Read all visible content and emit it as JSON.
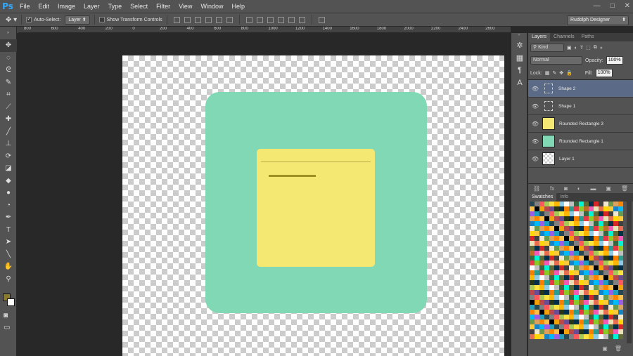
{
  "app": {
    "logo": "Ps"
  },
  "menu": [
    "File",
    "Edit",
    "Image",
    "Layer",
    "Type",
    "Select",
    "Filter",
    "View",
    "Window",
    "Help"
  ],
  "window_controls": [
    "—",
    "□",
    "✕"
  ],
  "options_bar": {
    "auto_select_label": "Auto-Select:",
    "auto_select_checked": true,
    "target_value": "Layer",
    "transform_label": "Show Transform Controls",
    "transform_checked": false,
    "workspace": "Rudolph Designer"
  },
  "ruler_ticks": [
    "800",
    "600",
    "400",
    "200",
    "0",
    "200",
    "400",
    "600",
    "800",
    "1000",
    "1200",
    "1400",
    "1600",
    "1800",
    "2000",
    "2200",
    "2400",
    "2600"
  ],
  "tools": [
    {
      "name": "move-tool-icon",
      "glyph": "✥"
    },
    {
      "name": "marquee-tool-icon",
      "glyph": "◌"
    },
    {
      "name": "lasso-tool-icon",
      "glyph": "ᘓ"
    },
    {
      "name": "quick-select-tool-icon",
      "glyph": "✎"
    },
    {
      "name": "crop-tool-icon",
      "glyph": "⌗"
    },
    {
      "name": "eyedropper-tool-icon",
      "glyph": "⟋"
    },
    {
      "name": "healing-tool-icon",
      "glyph": "✚"
    },
    {
      "name": "brush-tool-icon",
      "glyph": "╱"
    },
    {
      "name": "stamp-tool-icon",
      "glyph": "⊥"
    },
    {
      "name": "history-brush-tool-icon",
      "glyph": "⟳"
    },
    {
      "name": "eraser-tool-icon",
      "glyph": "◪"
    },
    {
      "name": "bucket-tool-icon",
      "glyph": "◆"
    },
    {
      "name": "blur-tool-icon",
      "glyph": "●"
    },
    {
      "name": "dodge-tool-icon",
      "glyph": "◔"
    },
    {
      "name": "pen-tool-icon",
      "glyph": "✒"
    },
    {
      "name": "type-tool-icon",
      "glyph": "T"
    },
    {
      "name": "path-select-tool-icon",
      "glyph": "➤"
    },
    {
      "name": "line-tool-icon",
      "glyph": "╲"
    },
    {
      "name": "hand-tool-icon",
      "glyph": "✋"
    },
    {
      "name": "zoom-tool-icon",
      "glyph": "⚲"
    }
  ],
  "colors": {
    "foreground": "#8a7a2e",
    "background": "#ffffff",
    "green_shape": "#81d8b4",
    "yellow_shape": "#f4e872",
    "thin_line": "#b9ae45",
    "thick_line": "#9c9022"
  },
  "panel_icons": [
    {
      "name": "adjustments-icon",
      "glyph": "✲"
    },
    {
      "name": "styles-icon",
      "glyph": "▦"
    },
    {
      "name": "paragraph-icon",
      "glyph": "¶"
    },
    {
      "name": "character-icon",
      "glyph": "A"
    }
  ],
  "layers_panel": {
    "tabs": [
      "Layers",
      "Channels",
      "Paths"
    ],
    "filter_kind": "Kind",
    "blend_mode": "Normal",
    "opacity_label": "Opacity:",
    "opacity_value": "100%",
    "lock_label": "Lock:",
    "fill_label": "Fill:",
    "fill_value": "100%",
    "layers": [
      {
        "name": "Shape 2",
        "thumb": "shape",
        "selected": true
      },
      {
        "name": "Shape 1",
        "thumb": "shape",
        "selected": false
      },
      {
        "name": "Rounded Rectangle 3",
        "thumb": "#f4e872",
        "selected": false
      },
      {
        "name": "Rounded Rectangle 1",
        "thumb": "#81d8b4",
        "selected": false
      },
      {
        "name": "Layer 1",
        "thumb": "checker",
        "selected": false
      }
    ],
    "footer_icons": [
      "link-icon",
      "fx-icon",
      "mask-icon",
      "adjustment-layer-icon",
      "group-icon",
      "new-layer-icon",
      "trash-icon"
    ]
  },
  "swatches_panel": {
    "tabs": [
      "Swatches",
      "Info"
    ]
  }
}
